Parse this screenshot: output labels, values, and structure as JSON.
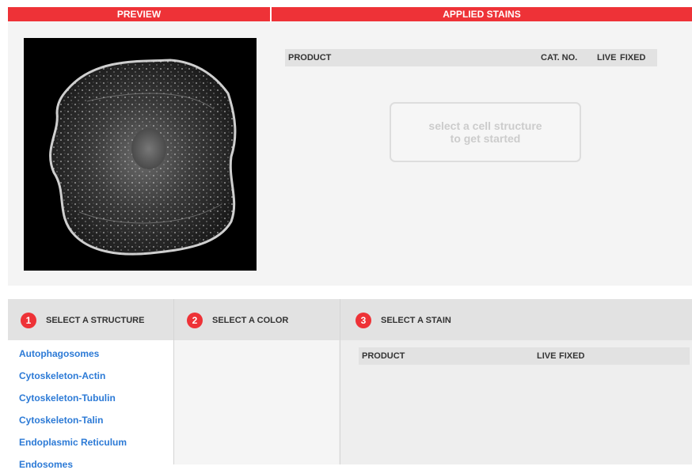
{
  "headers": {
    "preview": "PREVIEW",
    "applied_stains": "APPLIED STAINS"
  },
  "applied_table": {
    "col_product": "PRODUCT",
    "col_cat_no": "CAT. NO.",
    "col_live": "LIVE",
    "col_fixed": "FIXED"
  },
  "empty_message": "select a cell structure\nto get started",
  "steps": [
    {
      "num": "1",
      "label": "SELECT A STRUCTURE"
    },
    {
      "num": "2",
      "label": "SELECT A COLOR"
    },
    {
      "num": "3",
      "label": "SELECT A STAIN"
    }
  ],
  "structures": [
    "Autophagosomes",
    "Cytoskeleton-Actin",
    "Cytoskeleton-Tubulin",
    "Cytoskeleton-Talin",
    "Endoplasmic Reticulum",
    "Endosomes"
  ],
  "stain_table": {
    "col_product": "PRODUCT",
    "col_live": "LIVE",
    "col_fixed": "FIXED"
  },
  "colors": {
    "accent": "#ee3237",
    "link": "#2c7ad6"
  }
}
